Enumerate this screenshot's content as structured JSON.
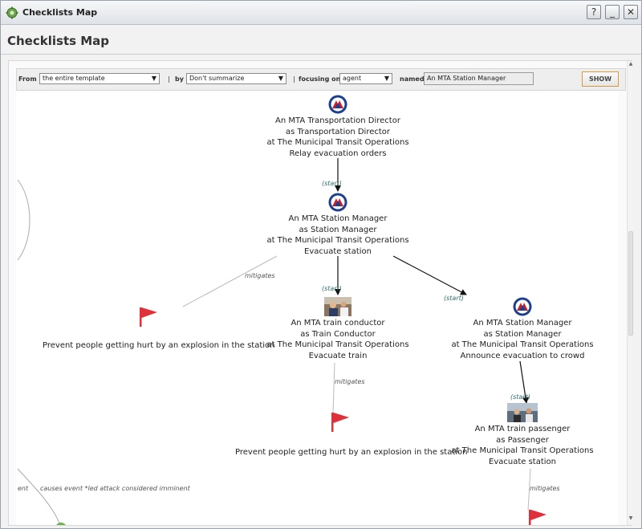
{
  "window": {
    "title": "Checklists Map",
    "buttons": {
      "help": "?",
      "minimize": "_",
      "close": "✕"
    }
  },
  "header": {
    "title": "Checklists Map"
  },
  "toolbar": {
    "from_label": "From",
    "from_value": "the entire template",
    "sep1": "|",
    "by_label": "by",
    "by_value": "Don't summarize",
    "sep2": "|",
    "focusing_label": "focusing on",
    "focusing_value": "agent",
    "named_label": "named",
    "named_value": "An MTA Station Manager",
    "show_label": "SHOW"
  },
  "nodes": {
    "director": {
      "lines": [
        "An MTA Transportation Director",
        "as Transportation Director",
        "at The Municipal Transit Operations",
        "Relay evacuation orders"
      ],
      "icon": "mta-logo-icon"
    },
    "station_manager": {
      "lines": [
        "An MTA Station Manager",
        "as Station Manager",
        "at The Municipal Transit Operations",
        "Evacuate station"
      ],
      "icon": "mta-logo-icon"
    },
    "train_conductor": {
      "lines": [
        "An MTA train conductor",
        "as Train Conductor",
        "at The Municipal Transit Operations",
        "Evacuate train"
      ],
      "icon": "conductor-photo-icon"
    },
    "station_manager_2": {
      "lines": [
        "An MTA Station Manager",
        "as Station Manager",
        "at The Municipal Transit Operations",
        "Announce evacuation to crowd"
      ],
      "icon": "mta-logo-icon"
    },
    "train_passenger": {
      "lines": [
        "An MTA train passenger",
        "as Passenger",
        "at The Municipal Transit Operations",
        "Evacuate station"
      ],
      "icon": "passenger-photo-icon"
    }
  },
  "risks": {
    "left": "Prevent people getting hurt by an explosion in the station",
    "middle": "Prevent people getting hurt by an explosion in the station"
  },
  "edge_labels": {
    "start1": "(start)",
    "start2": "(start)",
    "start3": "(start)",
    "start4": "(start)",
    "mitigates1": "mitigates",
    "mitigates2": "mitigates",
    "mitigates3": "mitigates",
    "event_fragment": "ent",
    "causes_event": "causes event *led attack considered imminent"
  },
  "colors": {
    "flag": "#e0303a",
    "mta_blue": "#1c3f8f",
    "edge": "#111111",
    "mitigate_edge": "#bbbbbb",
    "show_border": "#d49a3d"
  }
}
